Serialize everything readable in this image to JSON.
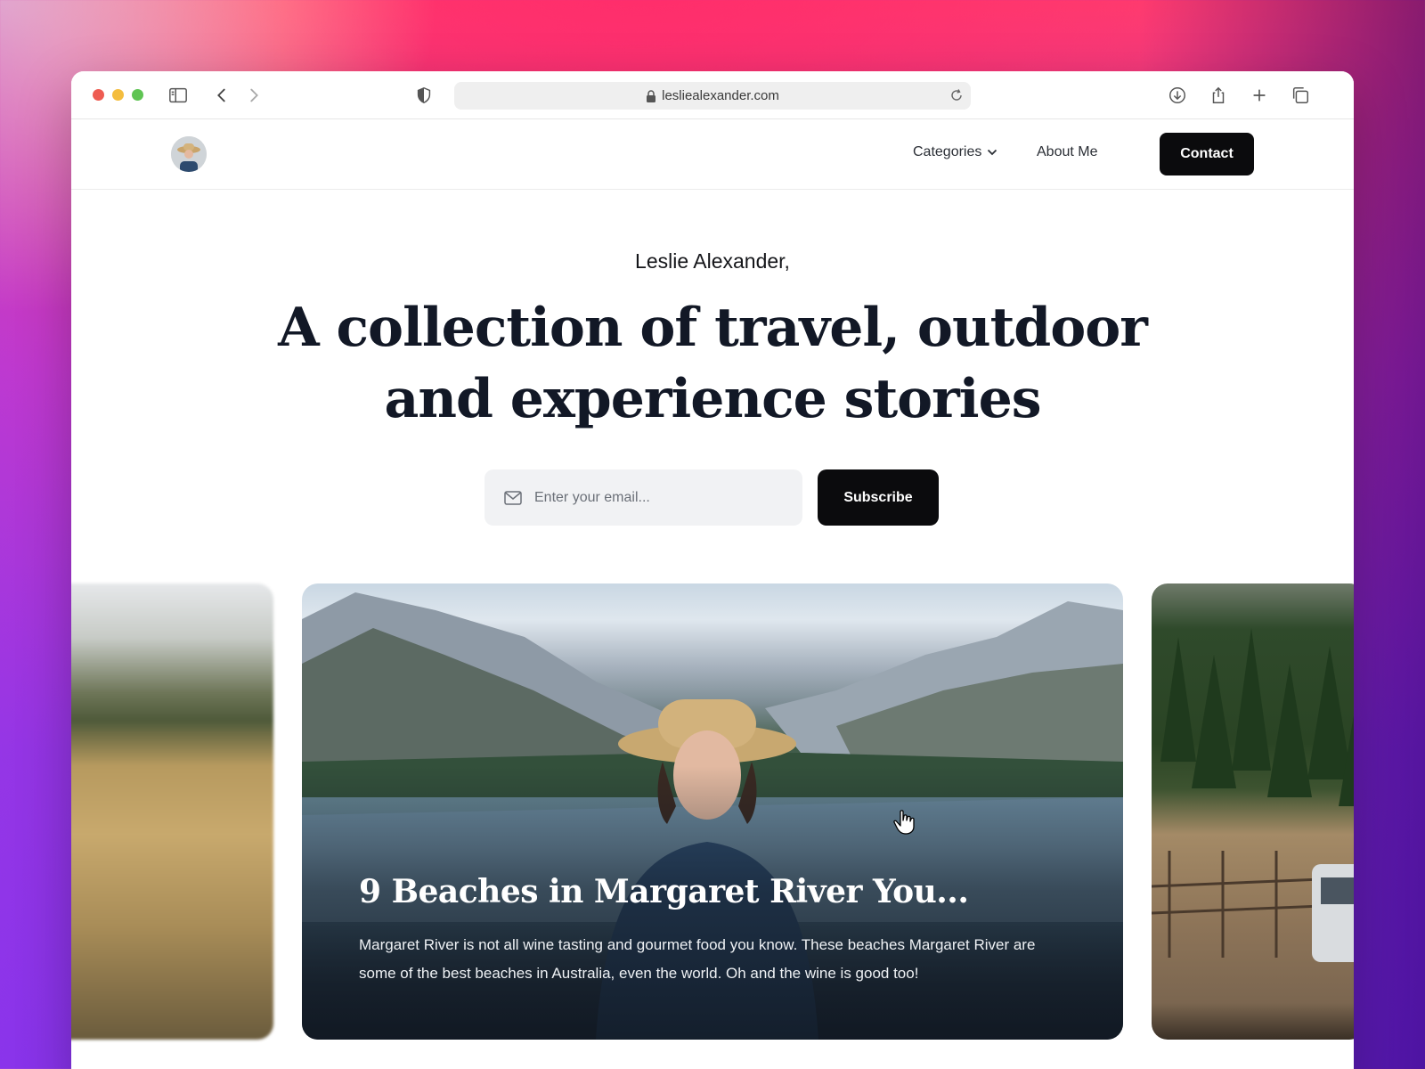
{
  "browser": {
    "url": "lesliealexander.com"
  },
  "nav": {
    "categories_label": "Categories",
    "about_label": "About Me",
    "contact_label": "Contact"
  },
  "hero": {
    "kicker": "Leslie Alexander,",
    "title": "A collection of travel, outdoor and experience stories",
    "email_placeholder": "Enter your email...",
    "subscribe_label": "Subscribe"
  },
  "featured_card": {
    "title": "9 Beaches in Margaret River You...",
    "excerpt": "Margaret River is not all wine tasting and gourmet food you know. These beaches Margaret River are some of the best beaches in Australia, even the world. Oh and the wine is good too!"
  },
  "icons": {
    "sidebar": "sidebar-icon",
    "back": "chevron-left-icon",
    "forward": "chevron-right-icon",
    "privacy": "shield-icon",
    "lock": "lock-icon",
    "reload": "reload-icon",
    "download": "download-icon",
    "share": "share-icon",
    "new_tab": "plus-icon",
    "tabs": "tabs-icon",
    "email": "mail-icon",
    "cursor": "hand-cursor-icon"
  },
  "colors": {
    "primary_button": "#0b0b0d",
    "heading": "#121826"
  }
}
